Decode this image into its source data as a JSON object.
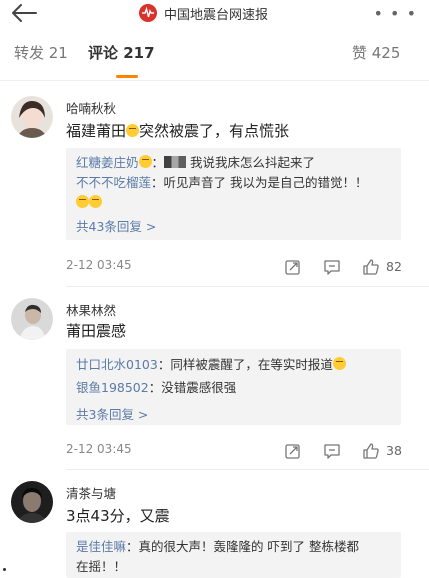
{
  "header": {
    "title": "中国地震台网速报",
    "more": "• • •"
  },
  "tabs": [
    {
      "label": "转发 21"
    },
    {
      "label": "评论 217"
    },
    {
      "label": "赞 425"
    }
  ],
  "comments": [
    {
      "name": "哈喃秋秋",
      "text_before": "福建莆田",
      "text_after": "突然被震了，有点慌张",
      "replies": [
        {
          "name": "红糖姜庄奶",
          "text": "我说我床怎么抖起来了"
        },
        {
          "name": "不不不吃榴莲",
          "text": "：听见声音了 我以为是自己的错觉！！"
        }
      ],
      "more_replies": "共43条回复 >",
      "time": "2-12 03:45",
      "likes": "82"
    },
    {
      "name": "林果林然",
      "text": "莆田震感",
      "replies": [
        {
          "name": "廿口北水0103",
          "text": "：同样被震醒了，在等实时报道"
        },
        {
          "name": "银鱼198502",
          "text": "：没错震感很强"
        }
      ],
      "more_replies": "共3条回复 >",
      "time": "2-12 03:45",
      "likes": "38"
    },
    {
      "name": "清茶与塘",
      "text": "3点43分，又震",
      "replies": [
        {
          "name": "是佳佳嘛",
          "text": "：真的很大声！轰隆隆的 吓到了 整栋楼都",
          "text2": "在摇！！"
        }
      ]
    }
  ],
  "icons": {
    "back": "arrow-left-icon",
    "repost": "repost-icon",
    "comment": "comment-icon",
    "like": "thumbs-up-icon"
  },
  "colors": {
    "accent": "#ff8200",
    "link": "#5b7ba8"
  }
}
